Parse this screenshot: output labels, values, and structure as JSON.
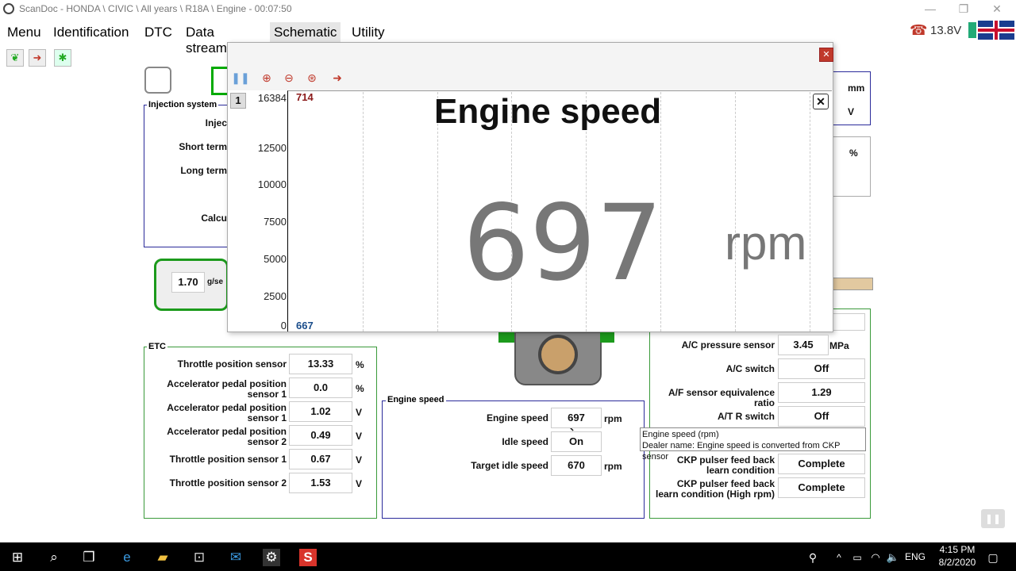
{
  "titlebar": {
    "title": "ScanDoc - HONDA \\ CIVIC \\ All years \\ R18A \\ Engine - 00:07:50",
    "minimize_icon": "minimize-icon",
    "restore_icon": "restore-icon",
    "close_icon": "close-icon"
  },
  "menu": {
    "items": [
      "Menu",
      "Identification",
      "DTC",
      "Data stream",
      "Schematic",
      "Utility"
    ],
    "active": "Schematic"
  },
  "status": {
    "voltage": "13.8V",
    "icons": [
      "phone-icon",
      "battery-icon",
      "uk-flag-icon"
    ]
  },
  "toolbar": {
    "icons": [
      "leaf-icon",
      "red-arrow-icon",
      "bug-icon"
    ]
  },
  "injection": {
    "title": "Injection system",
    "rows": [
      "Injec",
      "Short term",
      "Long term",
      "Calcu"
    ]
  },
  "maf": {
    "value": "1.70",
    "unit": "g/se"
  },
  "right_top": {
    "units": [
      "mm",
      "V",
      "%"
    ]
  },
  "popup": {
    "tools": [
      "pause-icon",
      "zoom-in-icon",
      "zoom-out-icon",
      "zoom-fit-icon",
      "export-arrow-icon"
    ],
    "channel": "1",
    "max_marker": "714",
    "min_marker": "667",
    "title": "Engine speed",
    "value": "697",
    "unit": "rpm",
    "y_ticks": [
      "16384",
      "12500",
      "10000",
      "7500",
      "5000",
      "2500",
      "0"
    ]
  },
  "etc": {
    "title": "ETC",
    "rows": [
      {
        "label": "Throttle position sensor",
        "value": "13.33",
        "unit": "%"
      },
      {
        "label": "Accelerator pedal position sensor 1",
        "value": "0.0",
        "unit": "%"
      },
      {
        "label": "Accelerator pedal position sensor 1",
        "value": "1.02",
        "unit": "V"
      },
      {
        "label": "Accelerator pedal position sensor 2",
        "value": "0.49",
        "unit": "V"
      },
      {
        "label": "Throttle position sensor 1",
        "value": "0.67",
        "unit": "V"
      },
      {
        "label": "Throttle position sensor 2",
        "value": "1.53",
        "unit": "V"
      }
    ]
  },
  "engine_speed": {
    "title": "Engine speed",
    "rows": [
      {
        "label": "Engine speed",
        "value": "697",
        "unit": "rpm"
      },
      {
        "label": "Idle speed",
        "value": "On",
        "unit": ""
      },
      {
        "label": "Target idle speed",
        "value": "670",
        "unit": "rpm"
      }
    ]
  },
  "misc": {
    "rows": [
      {
        "label": "A/C pressure sensor",
        "value": "3.45",
        "unit": "MPa"
      },
      {
        "label": "A/C switch",
        "value": "Off",
        "unit": ""
      },
      {
        "label": "A/F sensor equivalence ratio",
        "value": "1.29",
        "unit": ""
      },
      {
        "label": "A/T R switch",
        "value": "Off",
        "unit": ""
      },
      {
        "label": "CKP pulser feed back learn condition",
        "value": "Complete",
        "unit": ""
      },
      {
        "label": "CKP pulser feed back learn condition (High rpm)",
        "value": "Complete",
        "unit": ""
      }
    ]
  },
  "tooltip": {
    "line1": "Engine speed  (rpm)",
    "line2": "Dealer name: Engine speed is converted from CKP sensor"
  },
  "taskbar": {
    "time": "4:15 PM",
    "date": "8/2/2020",
    "lang": "ENG"
  }
}
